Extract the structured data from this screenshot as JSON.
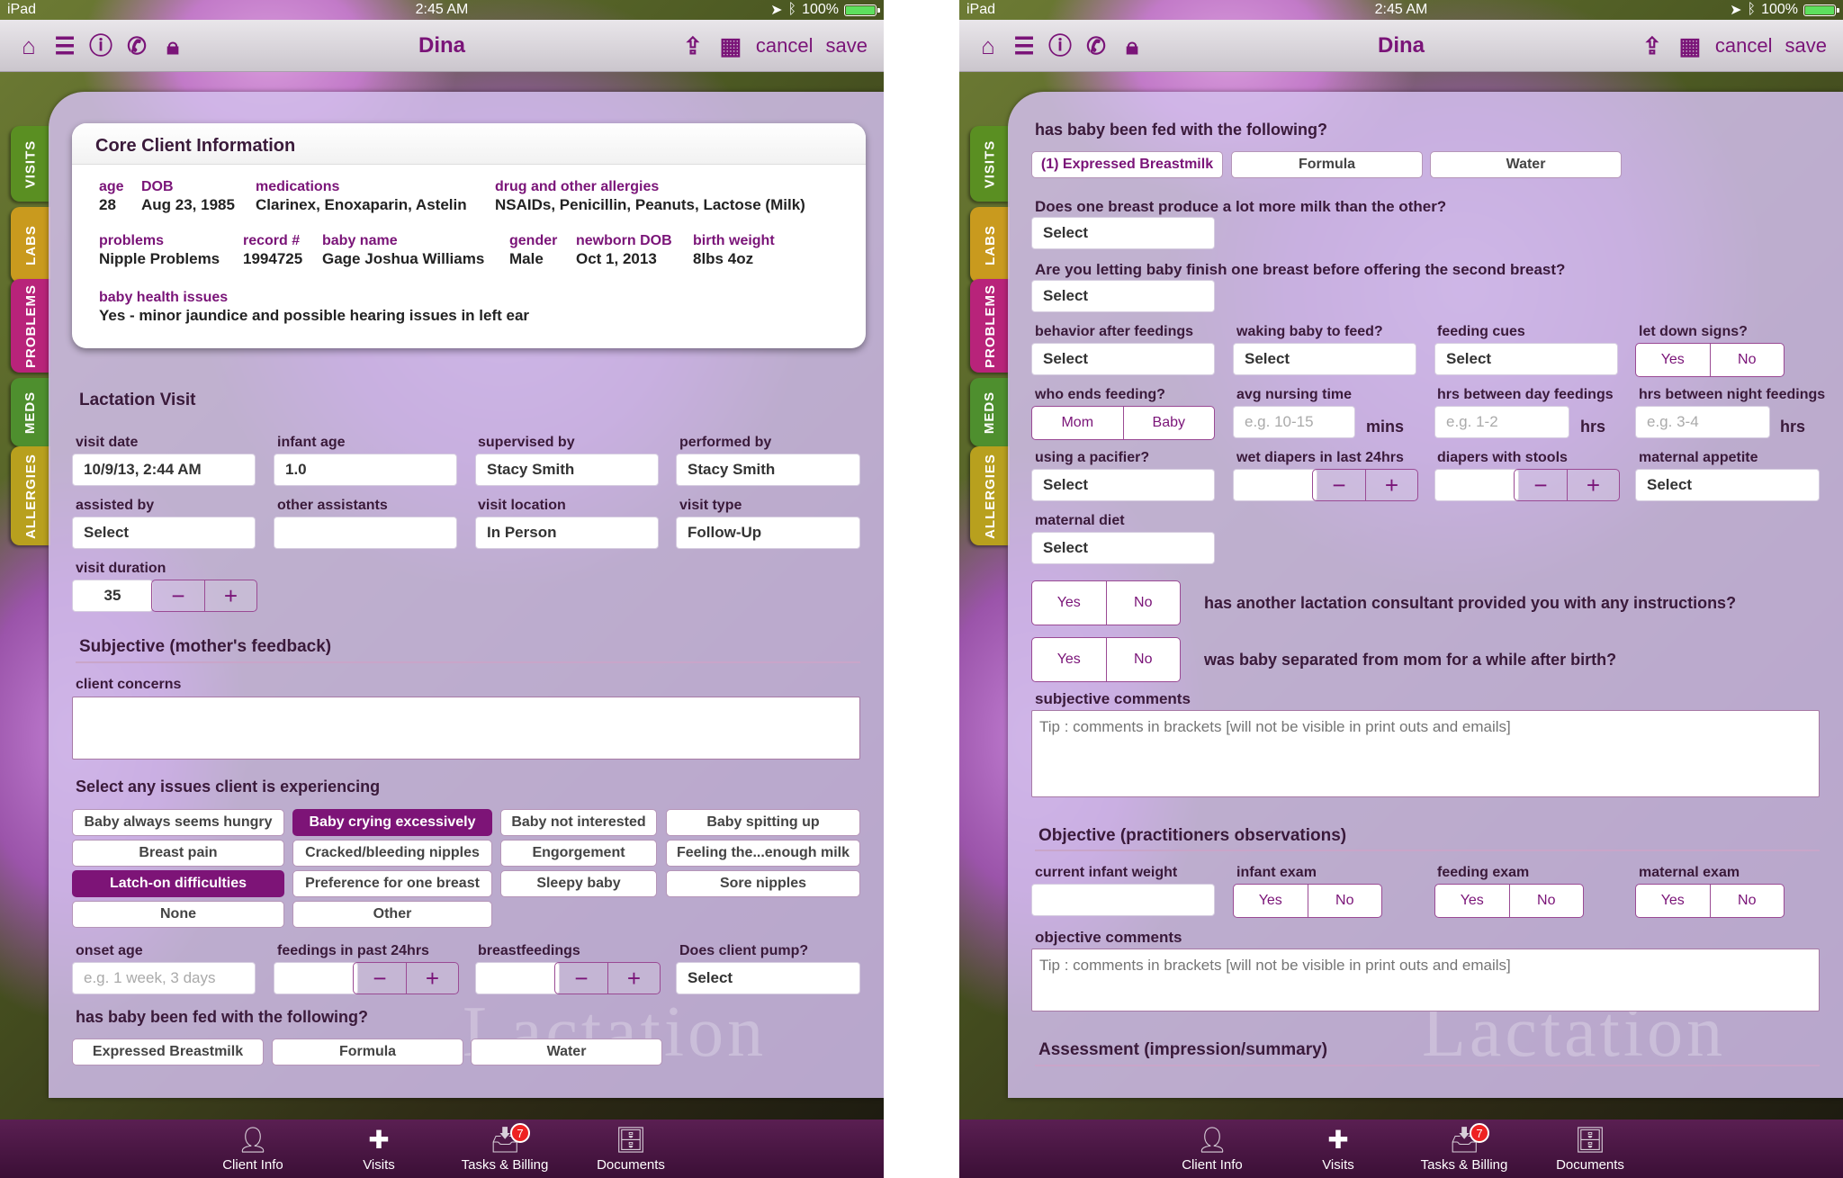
{
  "status": {
    "device": "iPad",
    "time": "2:45 AM",
    "battery": "100%"
  },
  "nav": {
    "title": "Dina",
    "cancel": "cancel",
    "save": "save"
  },
  "sidetabs": [
    {
      "label": "VISITS",
      "color": "#5a8f22"
    },
    {
      "label": "LABS",
      "color": "#c99a1e"
    },
    {
      "label": "PROBLEMS",
      "color": "#b8237a"
    },
    {
      "label": "MEDS",
      "color": "#4e8f2e"
    },
    {
      "label": "ALLERGIES",
      "color": "#b8a01e"
    }
  ],
  "tabbar": {
    "client_info": "Client Info",
    "visits": "Visits",
    "tasks": "Tasks & Billing",
    "tasks_badge": "7",
    "documents": "Documents"
  },
  "core": {
    "title": "Core Client Information",
    "age_l": "age",
    "age": "28",
    "dob_l": "DOB",
    "dob": "Aug 23, 1985",
    "meds_l": "medications",
    "meds": "Clarinex, Enoxaparin, Astelin",
    "allergies_l": "drug and other allergies",
    "allergies": "NSAIDs, Penicillin, Peanuts, Lactose (Milk)",
    "problems_l": "problems",
    "problems": "Nipple Problems",
    "record_l": "record #",
    "record": "1994725",
    "baby_l": "baby name",
    "baby": "Gage Joshua Williams",
    "gender_l": "gender",
    "gender": "Male",
    "ndob_l": "newborn DOB",
    "ndob": "Oct 1, 2013",
    "bw_l": "birth weight",
    "bw": "8lbs 4oz",
    "bhi_l": "baby health issues",
    "bhi": "Yes - minor jaundice and possible hearing issues in left ear"
  },
  "visit": {
    "title": "Lactation Visit",
    "visit_date_l": "visit date",
    "visit_date": "10/9/13, 2:44 AM",
    "infant_age_l": "infant age",
    "infant_age": "1.0",
    "supervised_l": "supervised by",
    "supervised": "Stacy Smith",
    "performed_l": "performed by",
    "performed": "Stacy Smith",
    "assisted_l": "assisted by",
    "assisted": "Select",
    "other_l": "other assistants",
    "other": "",
    "location_l": "visit location",
    "location": "In Person",
    "type_l": "visit type",
    "type": "Follow-Up",
    "duration_l": "visit duration",
    "duration": "35"
  },
  "subjective": {
    "title": "Subjective (mother's feedback)",
    "concerns_l": "client concerns",
    "issues_l": "Select any issues client is experiencing",
    "issues": [
      "Baby always seems hungry",
      "Baby crying excessively",
      "Baby not interested",
      "Baby spitting up",
      "Breast pain",
      "Cracked/bleeding nipples",
      "Engorgement",
      "Feeling the...enough milk",
      "Latch-on difficulties",
      "Preference for one breast",
      "Sleepy baby",
      "Sore nipples",
      "None",
      "Other"
    ],
    "onset_l": "onset age",
    "onset_ph": "e.g. 1 week, 3 days",
    "feedings_l": "feedings in past 24hrs",
    "breastfeedings_l": "breastfeedings",
    "pump_l": "Does client pump?",
    "pump": "Select",
    "fed_l": "has baby been fed with the following?",
    "fed": [
      "Expressed Breastmilk",
      "Formula",
      "Water"
    ]
  },
  "right": {
    "fed_l": "has baby been fed with the following?",
    "fed": [
      "(1) Expressed Breastmilk",
      "Formula",
      "Water"
    ],
    "q1": "Does one breast produce a lot more milk than the other?",
    "q1v": "Select",
    "q2": "Are you letting baby finish one breast before offering the second breast?",
    "q2v": "Select",
    "behavior_l": "behavior after feedings",
    "behavior": "Select",
    "waking_l": "waking baby to feed?",
    "waking": "Select",
    "cues_l": "feeding cues",
    "cues": "Select",
    "letdown_l": "let down signs?",
    "who_l": "who ends feeding?",
    "mom": "Mom",
    "baby": "Baby",
    "avg_l": "avg nursing time",
    "avg_ph": "e.g. 10-15",
    "mins": "mins",
    "hrsday_l": "hrs between day feedings",
    "hrsday_ph": "e.g. 1-2",
    "hrs": "hrs",
    "hrsnight_l": "hrs between night feedings",
    "hrsnight_ph": "e.g. 3-4",
    "pacifier_l": "using a pacifier?",
    "pacifier": "Select",
    "wet_l": "wet diapers in last 24hrs",
    "stools_l": "diapers with stools",
    "appetite_l": "maternal appetite",
    "appetite": "Select",
    "diet_l": "maternal diet",
    "diet": "Select",
    "yes": "Yes",
    "no": "No",
    "q3": "has another lactation consultant provided you with any instructions?",
    "q4": "was baby separated from mom for a while after birth?",
    "subj_comments_l": "subjective comments",
    "tip": "Tip : comments in brackets [will not be visible in print outs and emails]",
    "objective_title": "Objective (practitioners observations)",
    "weight_l": "current infant weight",
    "infant_exam_l": "infant exam",
    "feeding_exam_l": "feeding exam",
    "maternal_exam_l": "maternal exam",
    "obj_comments_l": "objective comments",
    "assessment_title": "Assessment (impression/summary)"
  }
}
